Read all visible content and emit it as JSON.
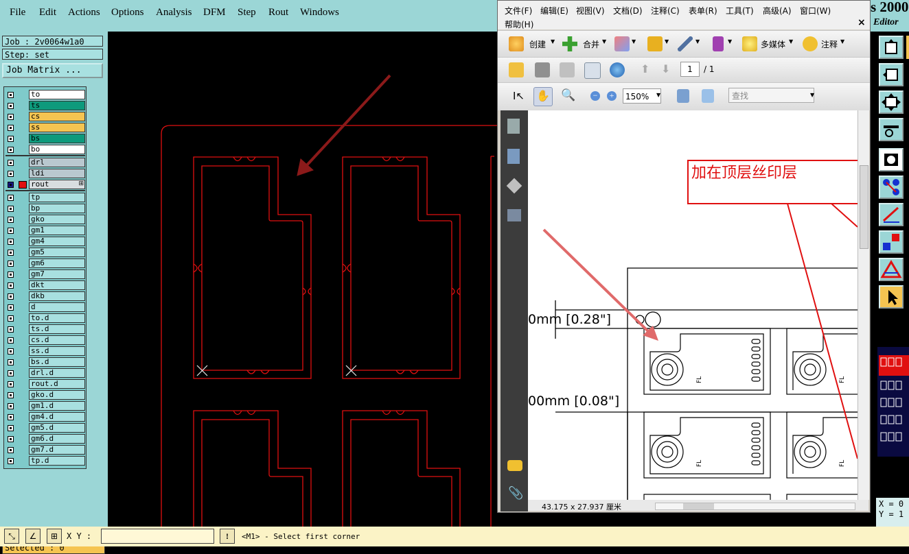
{
  "menubar": {
    "items": [
      "File",
      "Edit",
      "Actions",
      "Options",
      "Analysis",
      "DFM",
      "Step",
      "Rout",
      "Windows"
    ],
    "title_fragment": "s 2000",
    "editor_label": "Editor"
  },
  "left_panel": {
    "job": "Job : 2v0064w1a0",
    "step": "Step: set",
    "job_matrix_button": "Job Matrix ...",
    "layers_group1": [
      {
        "name": "to",
        "color": "white"
      },
      {
        "name": "ts",
        "color": "green"
      },
      {
        "name": "cs",
        "color": "orange"
      },
      {
        "name": "ss",
        "color": "orange"
      },
      {
        "name": "bs",
        "color": "green"
      },
      {
        "name": "bo",
        "color": "white"
      }
    ],
    "layers_group2": [
      {
        "name": "drl",
        "color": "gray"
      },
      {
        "name": "ldi",
        "color": "gray"
      },
      {
        "name": "rout",
        "color": "ltgray",
        "suffix": "⊞"
      }
    ],
    "layers_group3": [
      "tp",
      "bp",
      "gko",
      "gm1",
      "gm4",
      "gm5",
      "gm6",
      "gm7",
      "dkt",
      "dkb",
      "d",
      "to.d",
      "ts.d",
      "cs.d",
      "ss.d",
      "bs.d",
      "drl.d",
      "rout.d",
      "gko.d",
      "gm1.d",
      "gm4.d",
      "gm5.d",
      "gm6.d",
      "gm7.d",
      "tp.d"
    ],
    "selected": "Selected : 0"
  },
  "bottom_bar": {
    "xy_label": "X Y :",
    "prompt": "<M1> - Select first corner",
    "right_x": "X = 0",
    "right_y": "Y = 1"
  },
  "pdf_viewer": {
    "menu_row1": [
      "文件(F)",
      "编辑(E)",
      "视图(V)",
      "文档(D)",
      "注释(C)",
      "表单(R)",
      "工具(T)",
      "高级(A)",
      "窗口(W)"
    ],
    "menu_row2": [
      "帮助(H)"
    ],
    "close_glyph": "×",
    "toolbar1": [
      "创建",
      "合并",
      "多媒体",
      "注释"
    ],
    "page_current": "1",
    "page_total": "/ 1",
    "zoom": "150%",
    "search_placeholder": "查找",
    "status_size": "43.175 x 27.937 厘米",
    "annotation_text": "加在顶层丝印层",
    "dim_label_1": "0mm [0.28\"]",
    "dim_label_2": "00mm [0.08\"]",
    "part_label": "FL"
  },
  "colors": {
    "panel_bg": "#9bd6d6",
    "outline_red": "#e01010",
    "arrow_dark": "#8b1a1a",
    "arrow_light": "#e06a6a",
    "layer_green": "#0e9a7c",
    "layer_orange": "#f5c451"
  }
}
